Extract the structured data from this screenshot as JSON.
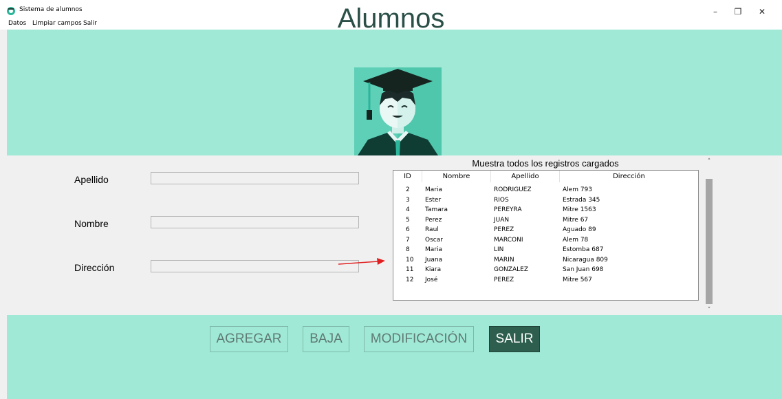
{
  "window": {
    "title": "Sistema de alumnos",
    "controls": {
      "minimize": "–",
      "maximize": "❐",
      "close": "✕"
    }
  },
  "menu": {
    "items": [
      "Datos",
      "Limpiar campos",
      "Salir"
    ]
  },
  "header": {
    "title": "Alumnos",
    "background": "#a0e9d6"
  },
  "form": {
    "apellido_label": "Apellido",
    "apellido_value": "",
    "nombre_label": "Nombre",
    "nombre_value": "",
    "direccion_label": "Dirección",
    "direccion_value": ""
  },
  "table": {
    "caption": "Muestra todos los registros cargados",
    "columns": [
      "ID",
      "Nombre",
      "Apellido",
      "Dirección"
    ],
    "rows": [
      [
        "2",
        "Maria",
        "RODRIGUEZ",
        "Alem 793"
      ],
      [
        "3",
        "Ester",
        "RIOS",
        "Estrada 345"
      ],
      [
        "4",
        "Tamara",
        "PEREYRA",
        "Mitre 1563"
      ],
      [
        "5",
        "Perez",
        "JUAN",
        "Mitre 67"
      ],
      [
        "6",
        "Raul",
        "PEREZ",
        "Aguado 89"
      ],
      [
        "7",
        "Oscar",
        "MARCONI",
        "Alem 78"
      ],
      [
        "8",
        "Maria",
        "LIN",
        "Estomba 687"
      ],
      [
        "10",
        "Juana",
        "MARIN",
        "Nicaragua 809"
      ],
      [
        "11",
        "Kiara",
        "GONZALEZ",
        "San Juan 698"
      ],
      [
        "12",
        "José",
        "PEREZ",
        "Mitre 567"
      ]
    ]
  },
  "buttons": {
    "agregar": "AGREGAR",
    "baja": "BAJA",
    "modificacion": "MODIFICACIÓN",
    "salir": "SALIR"
  },
  "colors": {
    "accent": "#a0e9d6",
    "salir_button": "#2e5e4e",
    "arrow": "#e02020"
  },
  "icons": {
    "app": "student-avatar-icon",
    "header_image": "graduate-avatar"
  }
}
